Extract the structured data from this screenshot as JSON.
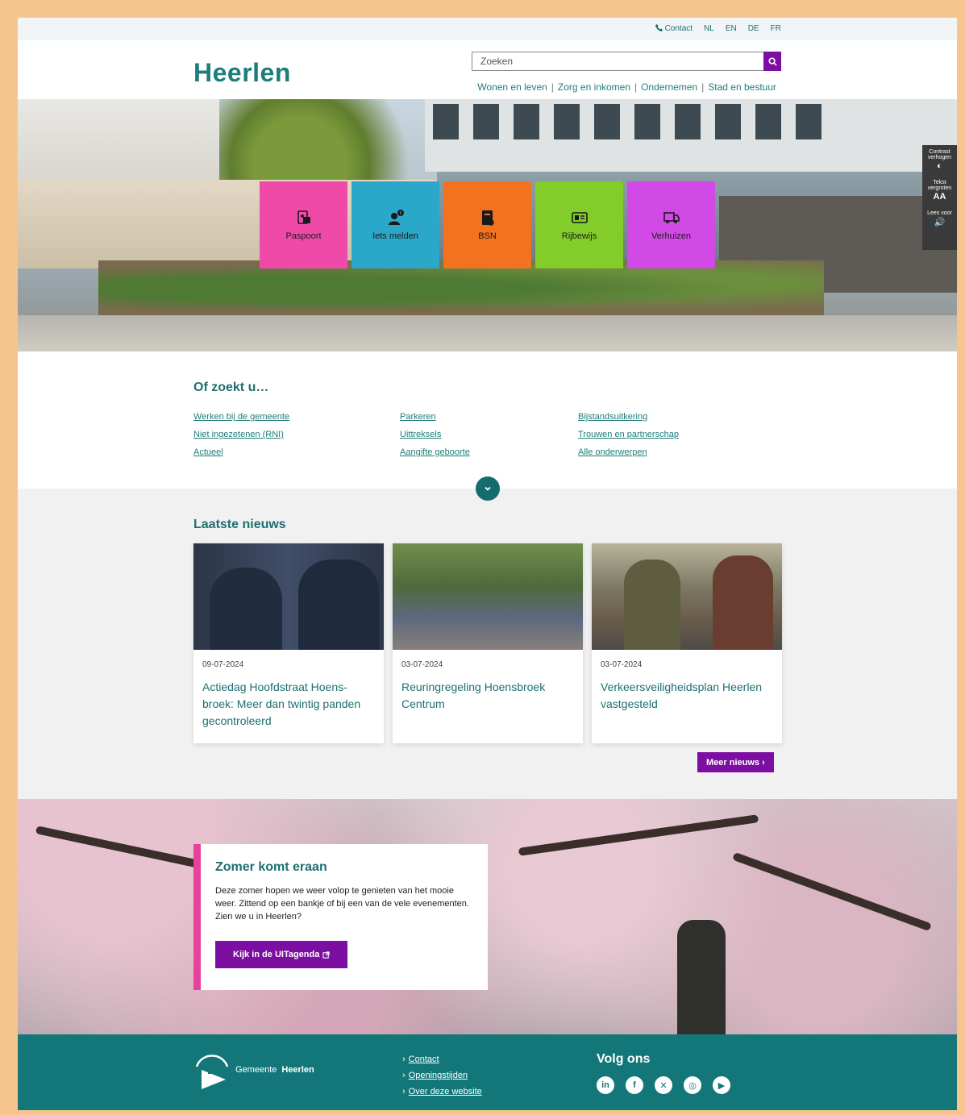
{
  "topbar": {
    "contact": "Contact",
    "languages": [
      "NL",
      "EN",
      "DE",
      "FR"
    ]
  },
  "header": {
    "logo": "Heerlen",
    "search_placeholder": "Zoeken",
    "nav": [
      "Wonen en leven",
      "Zorg en inkomen",
      "Ondernemen",
      "Stad en bestuur"
    ]
  },
  "tiles": [
    {
      "label": "Paspoort",
      "color": "#f04aa8",
      "icon": "passport-icon"
    },
    {
      "label": "Iets melden",
      "color": "#2aa7c9",
      "icon": "report-icon"
    },
    {
      "label": "BSN",
      "color": "#f2721f",
      "icon": "bsn-icon"
    },
    {
      "label": "Rijbewijs",
      "color": "#83cd2a",
      "icon": "license-icon"
    },
    {
      "label": "Verhuizen",
      "color": "#d24ae6",
      "icon": "moving-truck-icon"
    }
  ],
  "a11y": {
    "contrast": "Contrast verhogen",
    "text_size": "Tekst vergroten",
    "text_size_symbol": "AA",
    "read_aloud": "Lees voor"
  },
  "or_search": {
    "title": "Of zoekt u…",
    "links": [
      "Werken bij de gemeente",
      "Parkeren",
      "Bijstandsuitkering",
      "Niet ingezetenen (RNI)",
      "Uittreksels",
      "Trouwen en partnerschap",
      "Actueel",
      "Aangifte geboorte",
      "Alle onderwerpen"
    ]
  },
  "news": {
    "title": "Laatste nieuws",
    "items": [
      {
        "date": "09-07-2024",
        "title": "Actiedag Hoofdstraat Hoens-broek: Meer dan twintig panden gecontroleerd"
      },
      {
        "date": "03-07-2024",
        "title": "Reuringregeling Hoensbroek Centrum"
      },
      {
        "date": "03-07-2024",
        "title": "Verkeersveiligheidsplan Heerlen vastgesteld"
      }
    ],
    "more": "Meer nieuws"
  },
  "feature": {
    "title": "Zomer komt eraan",
    "text": "Deze zomer hopen we weer volop te genieten van het mooie weer. Zittend op een bankje of bij een van de vele evenementen. Zien we u in Heerlen?",
    "cta": "Kijk in de UITagenda"
  },
  "footer": {
    "logo_prefix": "Gemeente",
    "logo_name": "Heerlen",
    "links": [
      "Contact",
      "Openingstijden",
      "Over deze website"
    ],
    "follow": "Volg ons",
    "socials": [
      "linkedin-icon",
      "facebook-icon",
      "x-icon",
      "instagram-icon",
      "youtube-icon"
    ]
  },
  "colors": {
    "brand": "#1d7d7a",
    "accent": "#7c0fa1",
    "footer": "#13777a"
  }
}
